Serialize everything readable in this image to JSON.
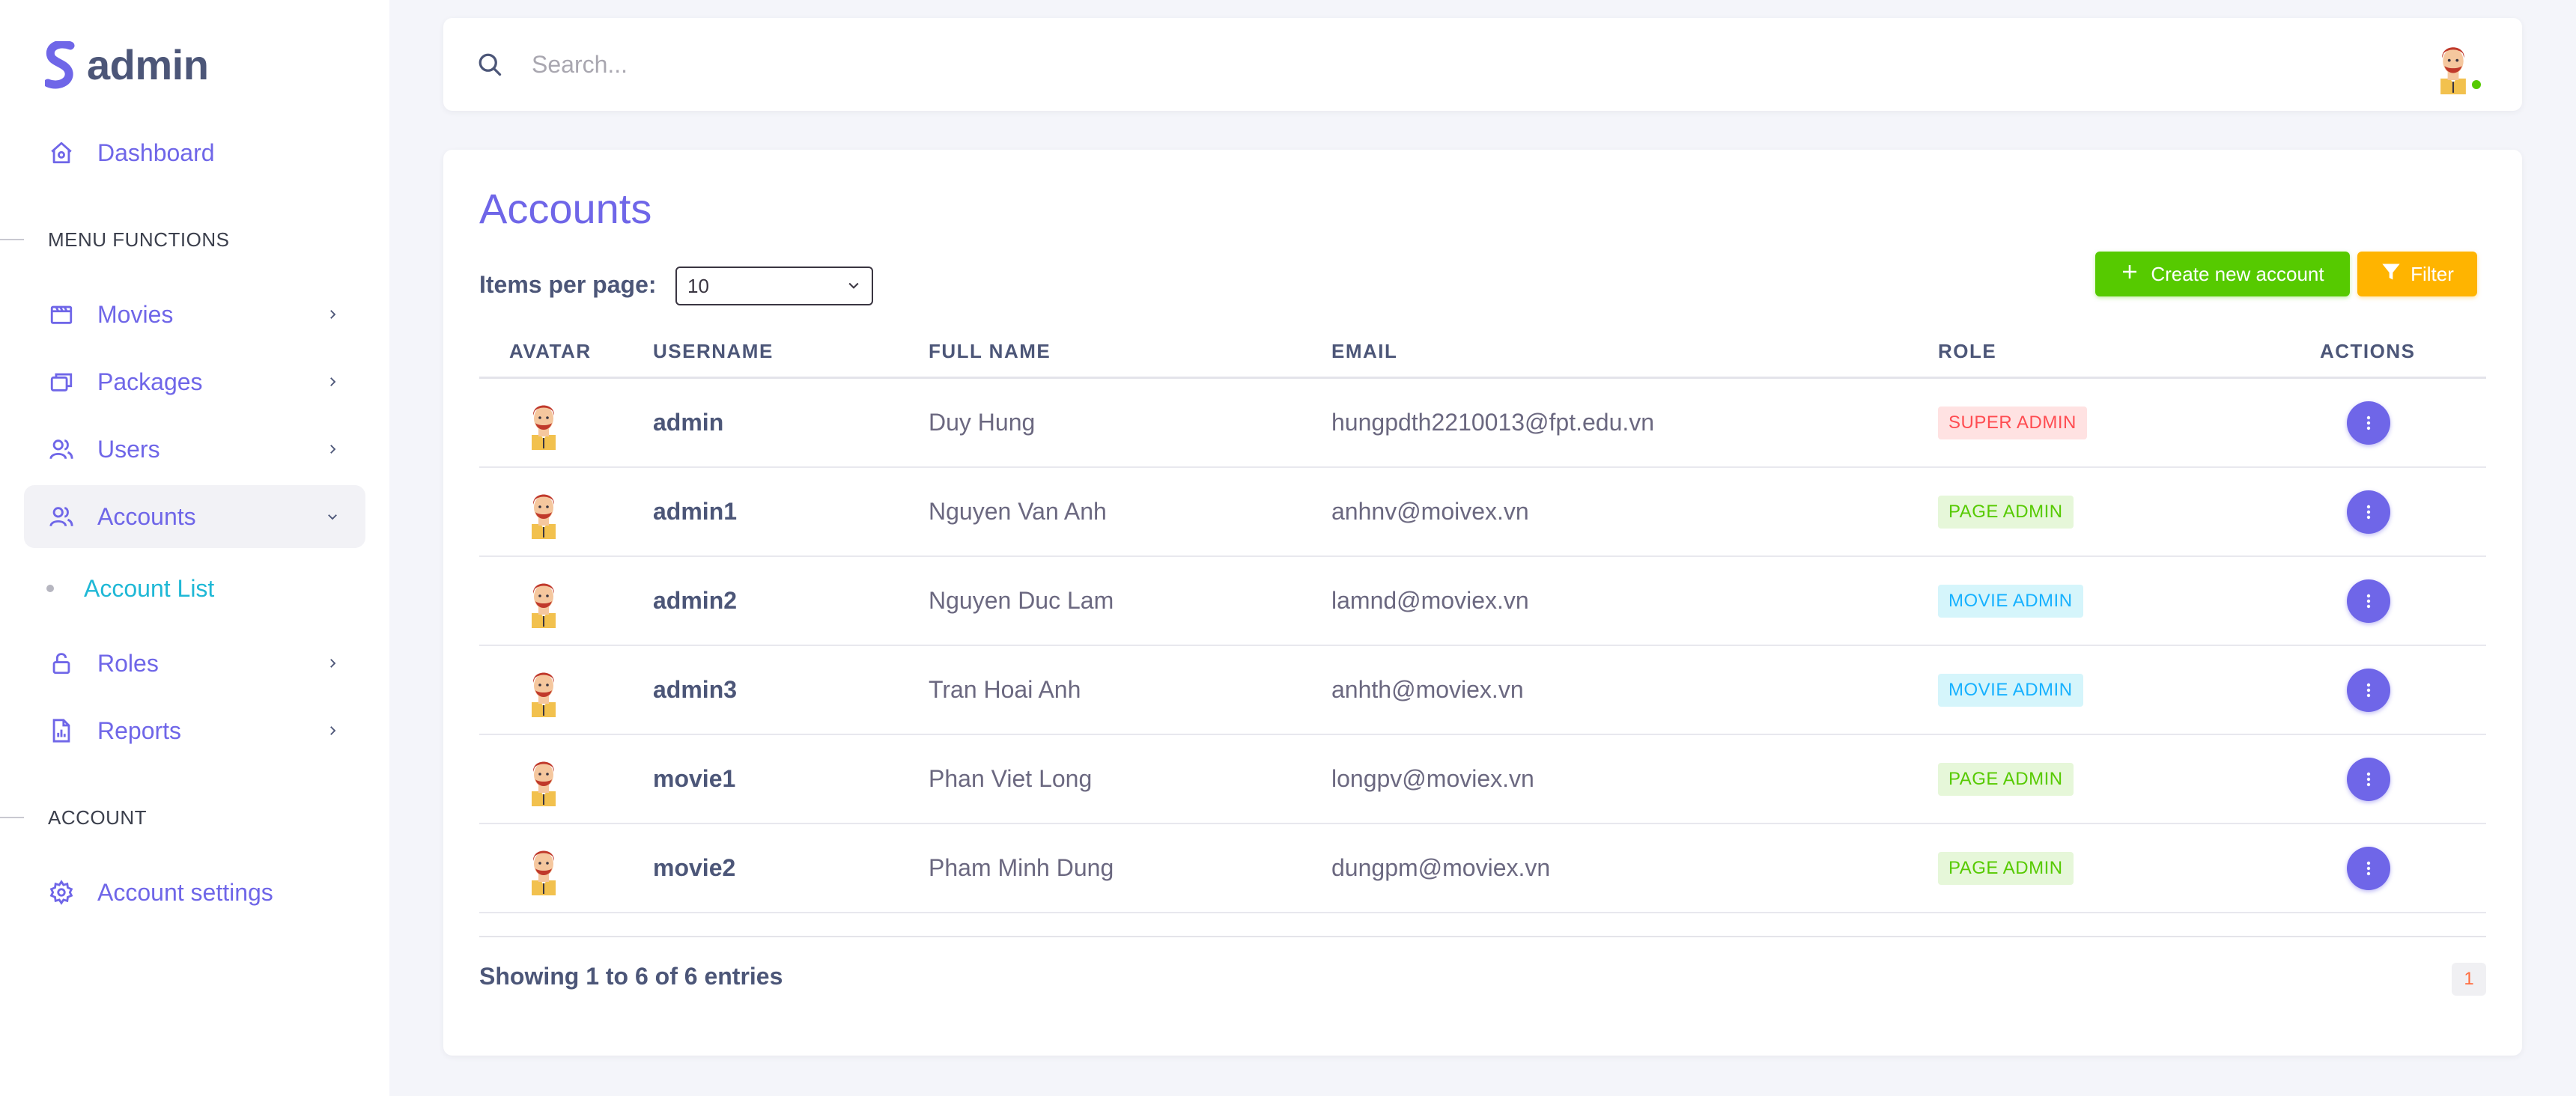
{
  "brand": {
    "name": "admin",
    "accent": "#6f66e8"
  },
  "sidebar": {
    "dashboard": {
      "label": "Dashboard",
      "icon": "home-icon"
    },
    "section_menu": "MENU FUNCTIONS",
    "items": [
      {
        "label": "Movies",
        "icon": "movie-icon"
      },
      {
        "label": "Packages",
        "icon": "packages-icon"
      },
      {
        "label": "Users",
        "icon": "users-icon"
      },
      {
        "label": "Accounts",
        "icon": "accounts-icon"
      },
      {
        "label": "Roles",
        "icon": "lock-icon"
      },
      {
        "label": "Reports",
        "icon": "report-icon"
      }
    ],
    "sub_item": "Account List",
    "section_account": "ACCOUNT",
    "account_settings": "Account settings"
  },
  "topbar": {
    "search_placeholder": "Search..."
  },
  "page": {
    "title": "Accounts",
    "items_per_page_label": "Items per page:",
    "items_per_page_value": "10",
    "create_button": "Create new account",
    "filter_button": "Filter",
    "columns": [
      "AVATAR",
      "USERNAME",
      "FULL NAME",
      "EMAIL",
      "ROLE",
      "ACTIONS"
    ],
    "rows": [
      {
        "username": "admin",
        "full_name": "Duy Hung",
        "email": "hungpdth2210013@fpt.edu.vn",
        "role": "SUPER ADMIN",
        "role_type": "super"
      },
      {
        "username": "admin1",
        "full_name": "Nguyen Van Anh",
        "email": "anhnv@moivex.vn",
        "role": "PAGE ADMIN",
        "role_type": "page"
      },
      {
        "username": "admin2",
        "full_name": "Nguyen Duc Lam",
        "email": "lamnd@moviex.vn",
        "role": "MOVIE ADMIN",
        "role_type": "movie"
      },
      {
        "username": "admin3",
        "full_name": "Tran Hoai Anh",
        "email": "anhth@moviex.vn",
        "role": "MOVIE ADMIN",
        "role_type": "movie"
      },
      {
        "username": "movie1",
        "full_name": "Phan Viet Long",
        "email": "longpv@moviex.vn",
        "role": "PAGE ADMIN",
        "role_type": "page"
      },
      {
        "username": "movie2",
        "full_name": "Pham Minh Dung",
        "email": "dungpm@moviex.vn",
        "role": "PAGE ADMIN",
        "role_type": "page"
      }
    ],
    "showing_text": "Showing 1 to 6 of 6 entries",
    "current_page": "1"
  },
  "colors": {
    "success": "#56ca00",
    "warning": "#ffb400",
    "error": "#ff4c51",
    "info": "#16b1ff",
    "sub_active": "#1fb8d6"
  }
}
